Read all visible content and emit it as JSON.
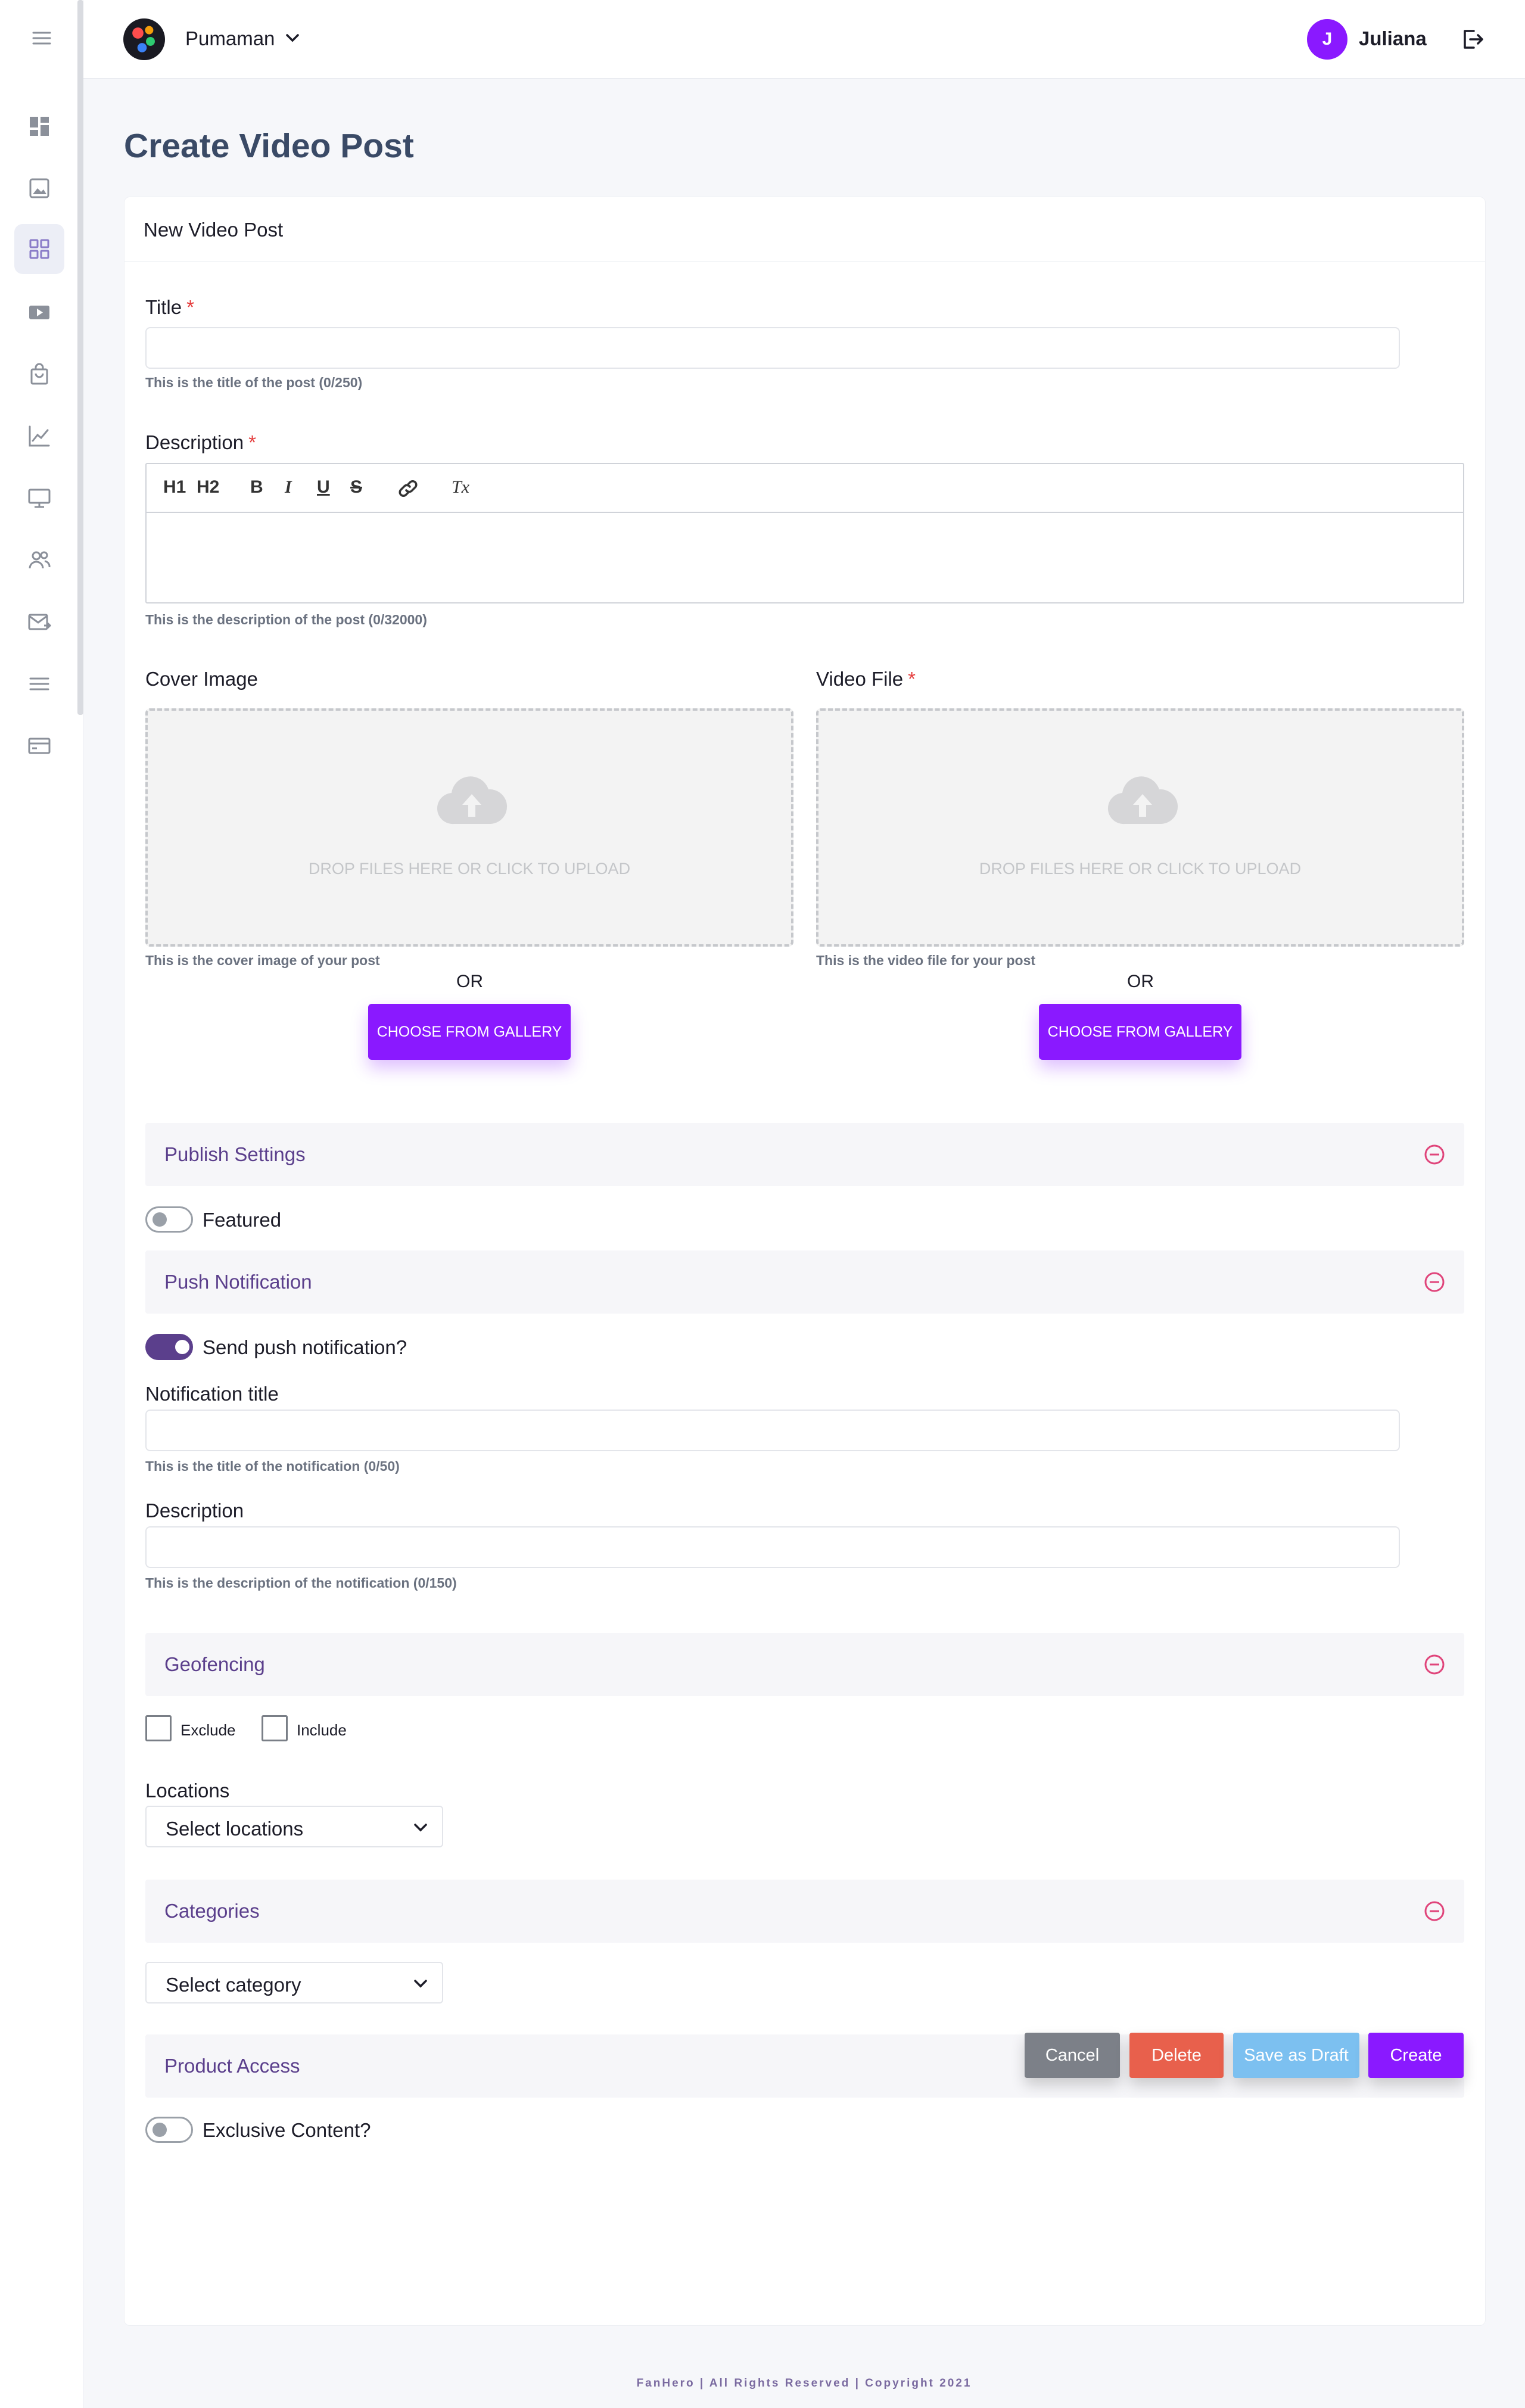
{
  "header": {
    "org_name": "Pumaman",
    "user_initial": "J",
    "user_name": "Juliana"
  },
  "sidebar": {
    "items": [
      "dashboard-icon",
      "image-icon",
      "grid-icon",
      "video-icon",
      "bag-icon",
      "chart-icon",
      "monitor-icon",
      "users-icon",
      "mail-icon",
      "list-icon",
      "card-icon"
    ],
    "active": "grid-icon"
  },
  "page": {
    "title": "Create Video Post",
    "card_header": "New Video Post"
  },
  "form": {
    "title_label": "Title",
    "title_hint": "This is the title of the post (0/250)",
    "description_label": "Description",
    "description_hint": "This is the description of the post (0/32000)",
    "toolbar": {
      "h1": "H1",
      "h2": "H2",
      "bold": "B",
      "italic": "I",
      "underline": "U",
      "strike": "S",
      "clear": "Tx"
    },
    "required_mark": "*",
    "cover_label": "Cover Image",
    "cover_hint": "This is the cover image of your post",
    "video_label": "Video File",
    "video_hint": "This is the video file for your post",
    "dropzone_text": "DROP FILES HERE OR CLICK TO UPLOAD",
    "or_text": "OR",
    "gallery_button": "CHOOSE FROM GALLERY"
  },
  "sections": {
    "publish": "Publish Settings",
    "featured_label": "Featured",
    "push": "Push Notification",
    "push_toggle_label": "Send push notification?",
    "notif_title_label": "Notification title",
    "notif_title_hint": "This is the title of the notification (0/50)",
    "notif_desc_label": "Description",
    "notif_desc_hint": "This is the description of the notification (0/150)",
    "geofencing": "Geofencing",
    "exclude_label": "Exclude",
    "include_label": "Include",
    "locations_label": "Locations",
    "locations_placeholder": "Select locations",
    "categories": "Categories",
    "category_placeholder": "Select category",
    "product_access": "Product Access",
    "exclusive_label": "Exclusive Content?"
  },
  "state": {
    "featured": false,
    "send_push": true,
    "exclude": false,
    "include": false,
    "exclusive": false
  },
  "actions": {
    "cancel": "Cancel",
    "delete": "Delete",
    "draft": "Save as Draft",
    "create": "Create"
  },
  "colors": {
    "accent": "#8a19ff",
    "section_title": "#5b3f8c",
    "collapse_icon": "#e0457b",
    "cancel": "#7c8088",
    "delete": "#e8604c",
    "draft": "#7cc0f0"
  },
  "footer": "FanHero | All Rights Reserved | Copyright 2021"
}
